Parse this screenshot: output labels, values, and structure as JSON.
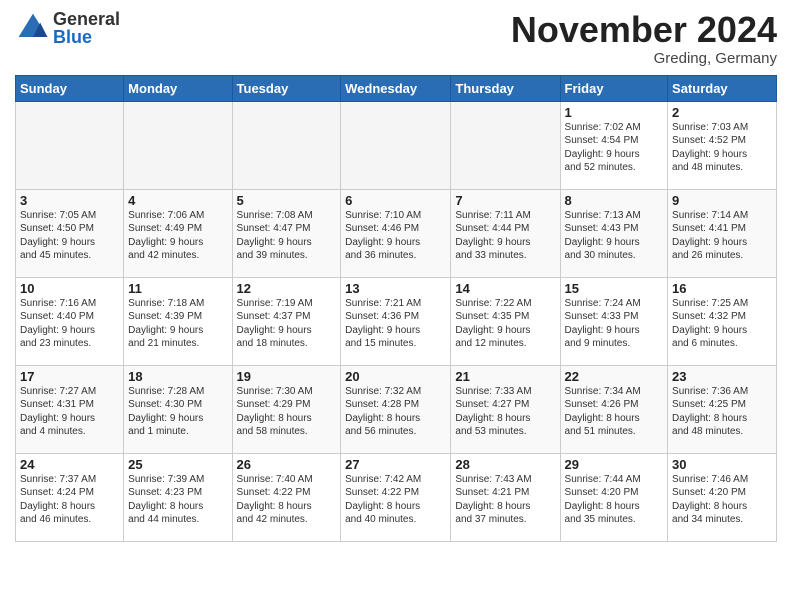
{
  "header": {
    "logo_general": "General",
    "logo_blue": "Blue",
    "month_title": "November 2024",
    "location": "Greding, Germany"
  },
  "days_of_week": [
    "Sunday",
    "Monday",
    "Tuesday",
    "Wednesday",
    "Thursday",
    "Friday",
    "Saturday"
  ],
  "weeks": [
    [
      {
        "day": "",
        "info": ""
      },
      {
        "day": "",
        "info": ""
      },
      {
        "day": "",
        "info": ""
      },
      {
        "day": "",
        "info": ""
      },
      {
        "day": "",
        "info": ""
      },
      {
        "day": "1",
        "info": "Sunrise: 7:02 AM\nSunset: 4:54 PM\nDaylight: 9 hours\nand 52 minutes."
      },
      {
        "day": "2",
        "info": "Sunrise: 7:03 AM\nSunset: 4:52 PM\nDaylight: 9 hours\nand 48 minutes."
      }
    ],
    [
      {
        "day": "3",
        "info": "Sunrise: 7:05 AM\nSunset: 4:50 PM\nDaylight: 9 hours\nand 45 minutes."
      },
      {
        "day": "4",
        "info": "Sunrise: 7:06 AM\nSunset: 4:49 PM\nDaylight: 9 hours\nand 42 minutes."
      },
      {
        "day": "5",
        "info": "Sunrise: 7:08 AM\nSunset: 4:47 PM\nDaylight: 9 hours\nand 39 minutes."
      },
      {
        "day": "6",
        "info": "Sunrise: 7:10 AM\nSunset: 4:46 PM\nDaylight: 9 hours\nand 36 minutes."
      },
      {
        "day": "7",
        "info": "Sunrise: 7:11 AM\nSunset: 4:44 PM\nDaylight: 9 hours\nand 33 minutes."
      },
      {
        "day": "8",
        "info": "Sunrise: 7:13 AM\nSunset: 4:43 PM\nDaylight: 9 hours\nand 30 minutes."
      },
      {
        "day": "9",
        "info": "Sunrise: 7:14 AM\nSunset: 4:41 PM\nDaylight: 9 hours\nand 26 minutes."
      }
    ],
    [
      {
        "day": "10",
        "info": "Sunrise: 7:16 AM\nSunset: 4:40 PM\nDaylight: 9 hours\nand 23 minutes."
      },
      {
        "day": "11",
        "info": "Sunrise: 7:18 AM\nSunset: 4:39 PM\nDaylight: 9 hours\nand 21 minutes."
      },
      {
        "day": "12",
        "info": "Sunrise: 7:19 AM\nSunset: 4:37 PM\nDaylight: 9 hours\nand 18 minutes."
      },
      {
        "day": "13",
        "info": "Sunrise: 7:21 AM\nSunset: 4:36 PM\nDaylight: 9 hours\nand 15 minutes."
      },
      {
        "day": "14",
        "info": "Sunrise: 7:22 AM\nSunset: 4:35 PM\nDaylight: 9 hours\nand 12 minutes."
      },
      {
        "day": "15",
        "info": "Sunrise: 7:24 AM\nSunset: 4:33 PM\nDaylight: 9 hours\nand 9 minutes."
      },
      {
        "day": "16",
        "info": "Sunrise: 7:25 AM\nSunset: 4:32 PM\nDaylight: 9 hours\nand 6 minutes."
      }
    ],
    [
      {
        "day": "17",
        "info": "Sunrise: 7:27 AM\nSunset: 4:31 PM\nDaylight: 9 hours\nand 4 minutes."
      },
      {
        "day": "18",
        "info": "Sunrise: 7:28 AM\nSunset: 4:30 PM\nDaylight: 9 hours\nand 1 minute."
      },
      {
        "day": "19",
        "info": "Sunrise: 7:30 AM\nSunset: 4:29 PM\nDaylight: 8 hours\nand 58 minutes."
      },
      {
        "day": "20",
        "info": "Sunrise: 7:32 AM\nSunset: 4:28 PM\nDaylight: 8 hours\nand 56 minutes."
      },
      {
        "day": "21",
        "info": "Sunrise: 7:33 AM\nSunset: 4:27 PM\nDaylight: 8 hours\nand 53 minutes."
      },
      {
        "day": "22",
        "info": "Sunrise: 7:34 AM\nSunset: 4:26 PM\nDaylight: 8 hours\nand 51 minutes."
      },
      {
        "day": "23",
        "info": "Sunrise: 7:36 AM\nSunset: 4:25 PM\nDaylight: 8 hours\nand 48 minutes."
      }
    ],
    [
      {
        "day": "24",
        "info": "Sunrise: 7:37 AM\nSunset: 4:24 PM\nDaylight: 8 hours\nand 46 minutes."
      },
      {
        "day": "25",
        "info": "Sunrise: 7:39 AM\nSunset: 4:23 PM\nDaylight: 8 hours\nand 44 minutes."
      },
      {
        "day": "26",
        "info": "Sunrise: 7:40 AM\nSunset: 4:22 PM\nDaylight: 8 hours\nand 42 minutes."
      },
      {
        "day": "27",
        "info": "Sunrise: 7:42 AM\nSunset: 4:22 PM\nDaylight: 8 hours\nand 40 minutes."
      },
      {
        "day": "28",
        "info": "Sunrise: 7:43 AM\nSunset: 4:21 PM\nDaylight: 8 hours\nand 37 minutes."
      },
      {
        "day": "29",
        "info": "Sunrise: 7:44 AM\nSunset: 4:20 PM\nDaylight: 8 hours\nand 35 minutes."
      },
      {
        "day": "30",
        "info": "Sunrise: 7:46 AM\nSunset: 4:20 PM\nDaylight: 8 hours\nand 34 minutes."
      }
    ]
  ]
}
